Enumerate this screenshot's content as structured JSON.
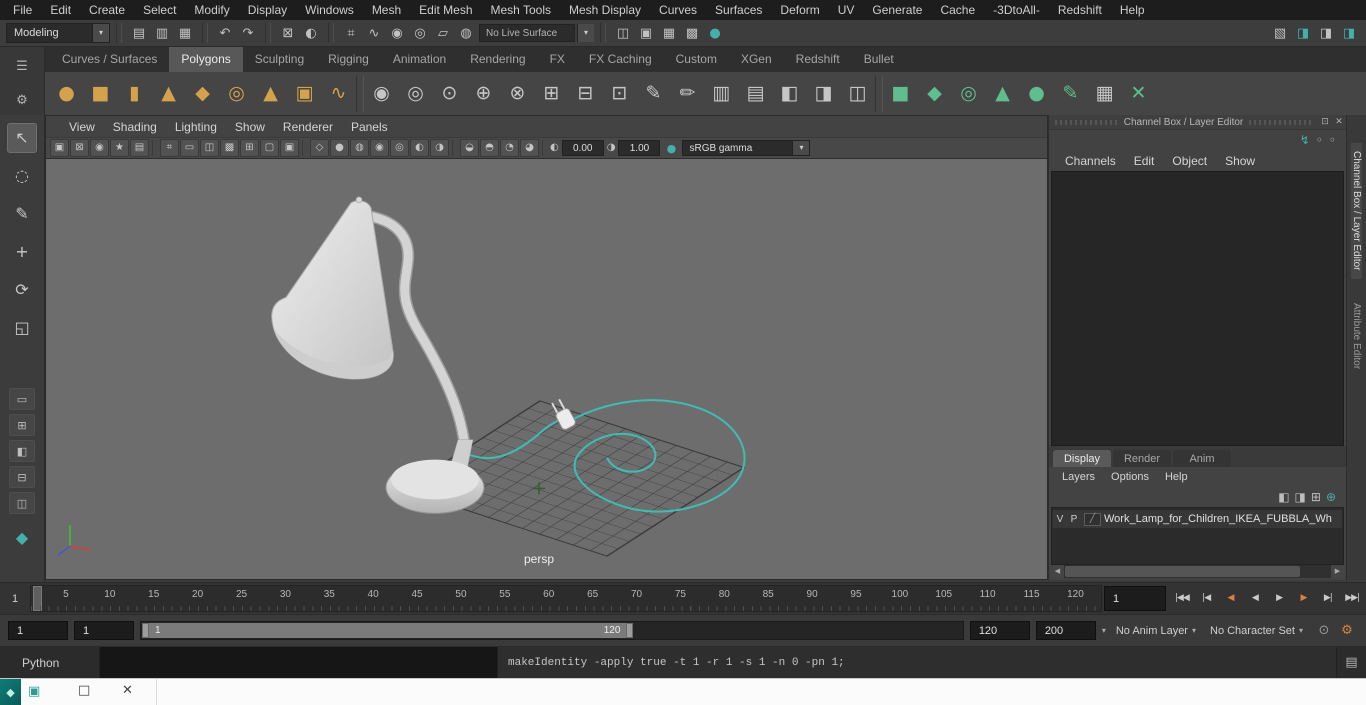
{
  "colors": {
    "teal": "#43b1a9",
    "gold": "#d3a24a",
    "green": "#5fbd8f",
    "orange": "#d9813f"
  },
  "menubar": {
    "items": [
      "File",
      "Edit",
      "Create",
      "Select",
      "Modify",
      "Display",
      "Windows",
      "Mesh",
      "Edit Mesh",
      "Mesh Tools",
      "Mesh Display",
      "Curves",
      "Surfaces",
      "Deform",
      "UV",
      "Generate",
      "Cache",
      "-3DtoAll-",
      "Redshift",
      "Help"
    ]
  },
  "statusline": {
    "mode": "Modeling",
    "live_surface": "No Live Surface",
    "file_icons": [
      {
        "name": "new-scene-icon",
        "glyph": "▤"
      },
      {
        "name": "open-scene-icon",
        "glyph": "▥"
      },
      {
        "name": "save-scene-icon",
        "glyph": "▦"
      }
    ],
    "history_icons": [
      {
        "name": "undo-icon",
        "glyph": "↶"
      },
      {
        "name": "redo-icon",
        "glyph": "↷"
      }
    ],
    "selection_icons": [
      {
        "name": "lock-selection-icon",
        "glyph": "⊠"
      },
      {
        "name": "highlight-selection-icon",
        "glyph": "◐"
      }
    ],
    "snap_icons": [
      {
        "name": "snap-to-grid-icon",
        "glyph": "⌗"
      },
      {
        "name": "snap-to-curve-icon",
        "glyph": "∿"
      },
      {
        "name": "snap-to-point-icon",
        "glyph": "◉"
      },
      {
        "name": "snap-to-projected-center-icon",
        "glyph": "◎"
      },
      {
        "name": "snap-to-view-plane-icon",
        "glyph": "▱"
      },
      {
        "name": "make-live-icon",
        "glyph": "◍"
      }
    ],
    "render_icons": [
      {
        "name": "render-view-icon",
        "glyph": "◫"
      },
      {
        "name": "render-frame-icon",
        "glyph": "▣"
      },
      {
        "name": "ipr-render-icon",
        "glyph": "▦"
      },
      {
        "name": "render-sequence-icon",
        "glyph": "▩"
      },
      {
        "name": "render-setup-icon",
        "glyph": "●",
        "color": "#43b1a9"
      }
    ],
    "sidebar_icons": [
      {
        "name": "workspace-icon",
        "glyph": "▧"
      },
      {
        "name": "modeling-toolkit-toggle-icon",
        "glyph": "◨",
        "color": "#43b1a9"
      },
      {
        "name": "attribute-editor-toggle-icon",
        "glyph": "◨"
      },
      {
        "name": "channel-box-toggle-icon",
        "glyph": "◨",
        "color": "#43b1a9"
      }
    ]
  },
  "shelf": {
    "menu_icons": [
      {
        "name": "shelf-tabs-menu-icon",
        "glyph": "☰"
      },
      {
        "name": "shelf-gear-icon",
        "glyph": "⚙"
      }
    ],
    "tabs": [
      {
        "label": "Curves / Surfaces"
      },
      {
        "label": "Polygons",
        "active": true
      },
      {
        "label": "Sculpting"
      },
      {
        "label": "Rigging"
      },
      {
        "label": "Animation"
      },
      {
        "label": "Rendering"
      },
      {
        "label": "FX"
      },
      {
        "label": "FX Caching"
      },
      {
        "label": "Custom"
      },
      {
        "label": "XGen"
      },
      {
        "label": "Redshift"
      },
      {
        "label": "Bullet"
      }
    ],
    "icons": [
      {
        "name": "poly-sphere-icon",
        "glyph": "●",
        "color": "#d3a24a"
      },
      {
        "name": "poly-cube-icon",
        "glyph": "■",
        "color": "#d3a24a"
      },
      {
        "name": "poly-cylinder-icon",
        "glyph": "▮",
        "color": "#d3a24a"
      },
      {
        "name": "poly-cone-icon",
        "glyph": "▲",
        "color": "#d3a24a"
      },
      {
        "name": "poly-platonic-icon",
        "glyph": "◆",
        "color": "#d3a24a"
      },
      {
        "name": "poly-torus-icon",
        "glyph": "◎",
        "color": "#d3a24a"
      },
      {
        "name": "poly-pyramid-icon",
        "glyph": "▲",
        "color": "#d3a24a"
      },
      {
        "name": "poly-pipe-icon",
        "glyph": "▣",
        "color": "#d3a24a"
      },
      {
        "name": "poly-helix-icon",
        "glyph": "∿",
        "color": "#d3a24a"
      },
      {
        "sep": true
      },
      {
        "name": "smooth-icon",
        "glyph": "◉"
      },
      {
        "name": "subdiv-proxy-icon",
        "glyph": "◎"
      },
      {
        "name": "boolean-icon",
        "glyph": "⊙"
      },
      {
        "name": "combine-icon",
        "glyph": "⊕"
      },
      {
        "name": "separate-icon",
        "glyph": "⊗"
      },
      {
        "name": "extrude-icon",
        "glyph": "⊞"
      },
      {
        "name": "bevel-icon",
        "glyph": "⊟"
      },
      {
        "name": "bridge-icon",
        "glyph": "⊡"
      },
      {
        "name": "multi-cut-icon",
        "glyph": "✎"
      },
      {
        "name": "quad-draw-icon",
        "glyph": "✏"
      },
      {
        "name": "insert-edge-loop-icon",
        "glyph": "▥"
      },
      {
        "name": "offset-edge-loop-icon",
        "glyph": "▤"
      },
      {
        "name": "mirror-icon",
        "glyph": "◧"
      },
      {
        "name": "align-icon",
        "glyph": "◨"
      },
      {
        "name": "center-pivot-icon",
        "glyph": "◫"
      },
      {
        "sep": true
      },
      {
        "name": "mt-extrude-icon",
        "glyph": "■",
        "color": "#5fbd8f"
      },
      {
        "name": "mt-bevel-icon",
        "glyph": "◆",
        "color": "#5fbd8f"
      },
      {
        "name": "mt-bridge-icon",
        "glyph": "◎",
        "color": "#5fbd8f"
      },
      {
        "name": "mt-multi-cut-icon",
        "glyph": "▲",
        "color": "#5fbd8f"
      },
      {
        "name": "mt-target-weld-icon",
        "glyph": "●",
        "color": "#5fbd8f"
      },
      {
        "name": "mt-quad-draw-icon",
        "glyph": "✎",
        "color": "#5fbd8f"
      },
      {
        "name": "uv-checker-icon",
        "glyph": "▦"
      },
      {
        "name": "transform-constraint-icon",
        "glyph": "✕",
        "color": "#5fbd8f"
      }
    ]
  },
  "toolbox": {
    "tools": [
      {
        "name": "select-tool",
        "glyph": "↖",
        "active": true
      },
      {
        "name": "lasso-select-tool",
        "glyph": "◌"
      },
      {
        "name": "paint-select-tool",
        "glyph": "✎"
      },
      {
        "name": "move-tool",
        "glyph": "+"
      },
      {
        "name": "rotate-tool",
        "glyph": "⟳"
      },
      {
        "name": "scale-tool",
        "glyph": "◱"
      }
    ],
    "layouts": [
      {
        "name": "layout-single-pane",
        "glyph": "▭"
      },
      {
        "name": "layout-four-pane",
        "glyph": "⊞"
      },
      {
        "name": "layout-persp-outliner",
        "glyph": "◧"
      },
      {
        "name": "layout-persp-graph",
        "glyph": "⊟"
      },
      {
        "name": "layout-hypershade",
        "glyph": "◫"
      }
    ],
    "extra": [
      {
        "name": "modeling-toolkit-icon",
        "glyph": "◆",
        "color": "#43b1a9"
      }
    ]
  },
  "viewport": {
    "menus": [
      "View",
      "Shading",
      "Lighting",
      "Show",
      "Renderer",
      "Panels"
    ],
    "toolbar_icons": [
      {
        "name": "select-camera-icon",
        "glyph": "▣"
      },
      {
        "name": "lock-camera-icon",
        "glyph": "⊠"
      },
      {
        "name": "camera-attributes-icon",
        "glyph": "◉"
      },
      {
        "name": "bookmark-icon",
        "glyph": "★"
      },
      {
        "name": "image-plane-icon",
        "glyph": "▤"
      },
      {
        "sep": true
      },
      {
        "name": "grid-toggle-icon",
        "glyph": "⌗"
      },
      {
        "name": "film-gate-icon",
        "glyph": "▭"
      },
      {
        "name": "resolution-gate-icon",
        "glyph": "◫"
      },
      {
        "name": "gate-mask-icon",
        "glyph": "▩"
      },
      {
        "name": "field-chart-icon",
        "glyph": "⊞"
      },
      {
        "name": "safe-action-icon",
        "glyph": "▢"
      },
      {
        "name": "safe-title-icon",
        "glyph": "▣"
      },
      {
        "sep": true
      },
      {
        "name": "wireframe-icon",
        "glyph": "◇"
      },
      {
        "name": "smooth-shade-icon",
        "glyph": "●"
      },
      {
        "name": "wireframe-on-shaded-icon",
        "glyph": "◍"
      },
      {
        "name": "textured-icon",
        "glyph": "◉"
      },
      {
        "name": "use-default-material-icon",
        "glyph": "◎"
      },
      {
        "name": "lighting-icon",
        "glyph": "◐"
      },
      {
        "name": "shadows-icon",
        "glyph": "◑"
      },
      {
        "sep": true
      },
      {
        "name": "occlusion-icon",
        "glyph": "◒"
      },
      {
        "name": "motion-blur-icon",
        "glyph": "◓"
      },
      {
        "name": "isolate-select-icon",
        "glyph": "◔"
      },
      {
        "name": "xray-icon",
        "glyph": "◕"
      },
      {
        "sep": true
      }
    ],
    "exposure_icon": {
      "name": "exposure-icon",
      "glyph": "◐"
    },
    "exposure": "0.00",
    "gamma_icon": {
      "name": "gamma-icon",
      "glyph": "◑"
    },
    "gamma": "1.00",
    "view_transform_toggle": {
      "name": "view-transform-toggle-icon",
      "glyph": "●",
      "color": "#43b1a9"
    },
    "view_transform": "sRGB gamma",
    "camera_label": "persp"
  },
  "channel_box": {
    "title": "Channel Box / Layer Editor",
    "window_icons": [
      {
        "name": "float-panel-icon",
        "glyph": "⊡"
      },
      {
        "name": "close-panel-icon",
        "glyph": "✕"
      }
    ],
    "quick_icons": [
      {
        "name": "speed-state-icon",
        "glyph": "↯",
        "color": "#43b1a9"
      },
      {
        "name": "manip-state-icon",
        "glyph": "◦"
      },
      {
        "name": "key-state-icon",
        "glyph": "◦"
      }
    ],
    "menus": [
      "Channels",
      "Edit",
      "Object",
      "Show"
    ],
    "layer_tabs": [
      {
        "label": "Display",
        "active": true
      },
      {
        "label": "Render"
      },
      {
        "label": "Anim"
      }
    ],
    "layer_menus": [
      "Layers",
      "Options",
      "Help"
    ],
    "layer_toolbar_icons": [
      {
        "name": "move-to-layer-icon",
        "glyph": "◧"
      },
      {
        "name": "select-layer-objects-icon",
        "glyph": "◨"
      },
      {
        "name": "new-layer-from-selected-icon",
        "glyph": "⊞"
      },
      {
        "name": "new-empty-layer-icon",
        "glyph": "⊕",
        "color": "#43b1a9"
      }
    ],
    "layers": [
      {
        "visible": "V",
        "playback": "P",
        "type": "╱",
        "name": "Work_Lamp_for_Children_IKEA_FUBBLA_Wh"
      }
    ],
    "side_tabs_first": "Channel Box / Layer Editor",
    "side_tabs_second": "Attribute Editor"
  },
  "time_slider": {
    "ticks": [
      "5",
      "10",
      "15",
      "20",
      "25",
      "30",
      "35",
      "40",
      "45",
      "50",
      "55",
      "60",
      "65",
      "70",
      "75",
      "80",
      "85",
      "90",
      "95",
      "100",
      "105",
      "110",
      "115",
      "120"
    ],
    "current_frame": "1",
    "frame_field": "1",
    "playback_buttons": [
      {
        "name": "go-to-start-button",
        "glyph": "|◀◀"
      },
      {
        "name": "step-back-frame-button",
        "glyph": "|◀"
      },
      {
        "name": "step-back-key-button",
        "glyph": "◀",
        "color": "#d9813f"
      },
      {
        "name": "play-backwards-button",
        "glyph": "◀"
      },
      {
        "name": "play-forwards-button",
        "glyph": "▶"
      },
      {
        "name": "step-forward-key-button",
        "glyph": "▶",
        "color": "#d9813f"
      },
      {
        "name": "step-forward-frame-button",
        "glyph": "▶|"
      },
      {
        "name": "go-to-end-button",
        "glyph": "▶▶|"
      }
    ]
  },
  "range_slider": {
    "animation_start": "1",
    "playback_start": "1",
    "range_start_label": "1",
    "range_end_label": "120",
    "playback_end": "120",
    "animation_end": "200",
    "anim_layer": "No Anim Layer",
    "character_set": "No Character Set",
    "icons": [
      {
        "name": "auto-key-icon",
        "glyph": "⊙"
      },
      {
        "name": "anim-preferences-icon",
        "glyph": "⚙",
        "color": "#d9813f"
      }
    ]
  },
  "command_line": {
    "language": "Python",
    "input_value": "",
    "result": "makeIdentity -apply true -t 1 -r 1 -s 1 -n 0 -pn 1;",
    "script_editor_glyph": "▤"
  },
  "bottom_bar": {
    "maya_tile_glyph": "◆",
    "window_icon_glyph": "▣",
    "restore_glyph": "□",
    "close_glyph": "✕"
  }
}
